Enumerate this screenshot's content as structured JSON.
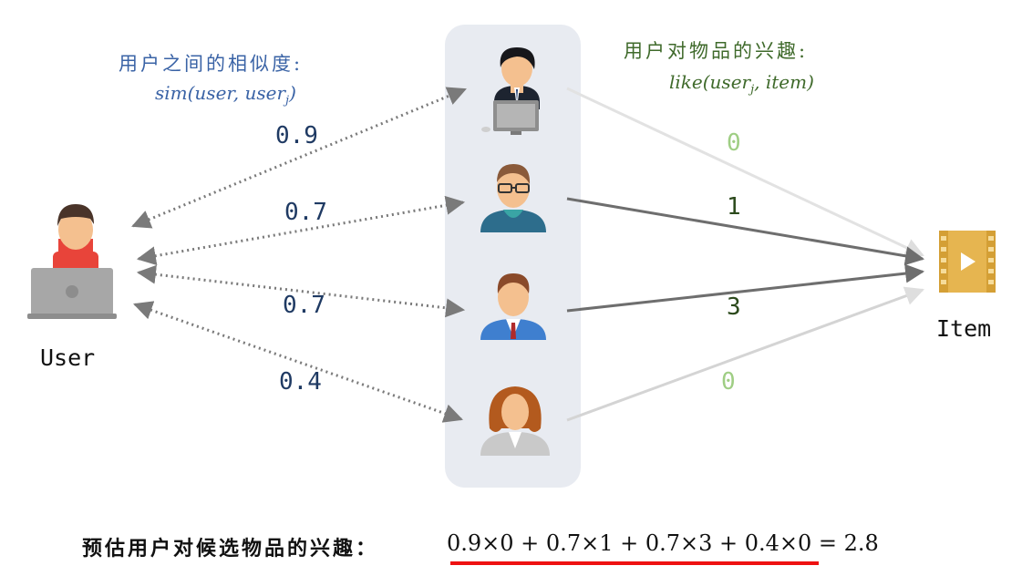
{
  "similarity_heading": "用户之间的相似度:",
  "similarity_formula": "sim(user, userj)",
  "interest_heading": "用户对物品的兴趣:",
  "interest_formula": "like(userj, item)",
  "user_label": "User",
  "item_label": "Item",
  "similarities": [
    "0.9",
    "0.7",
    "0.7",
    "0.4"
  ],
  "likes": [
    "0",
    "1",
    "3",
    "0"
  ],
  "bottom_label": "预估用户对候选物品的兴趣：",
  "bottom_equation": "0.9×0 + 0.7×1 + 0.7×3 + 0.4×0 = 2.8",
  "colors": {
    "heading_blue": "#3a63a6",
    "heading_green": "#3f6a2b",
    "like_zero": "#9fce84",
    "like_nonzero": "#2c4a1c",
    "panel": "#e8ebf1",
    "highlight": "#ee1111"
  },
  "icons": [
    "user-with-laptop-icon",
    "businessman-at-computer-icon",
    "man-with-glasses-icon",
    "man-in-suit-icon",
    "woman-icon",
    "video-file-icon"
  ]
}
